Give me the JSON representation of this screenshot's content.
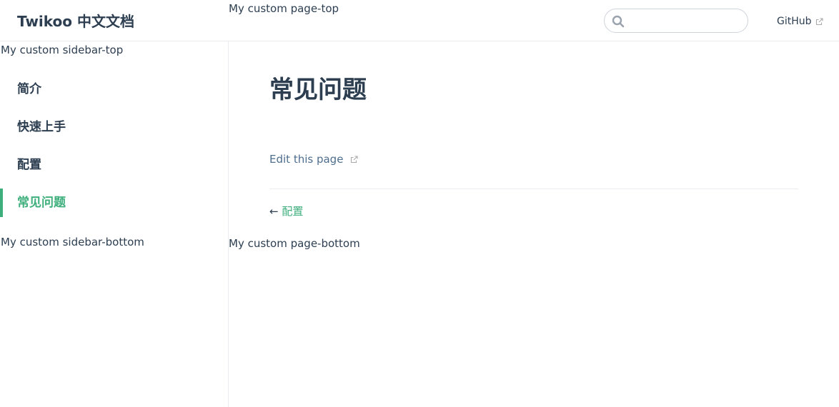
{
  "navbar": {
    "site_name": "Twikoo 中文文档",
    "search": {
      "value": "",
      "placeholder": ""
    },
    "links": [
      {
        "label": "GitHub"
      }
    ]
  },
  "page_top": "My custom page-top",
  "sidebar": {
    "top": "My custom sidebar-top",
    "items": [
      {
        "label": "简介",
        "active": false
      },
      {
        "label": "快速上手",
        "active": false
      },
      {
        "label": "配置",
        "active": false
      },
      {
        "label": "常见问题",
        "active": true
      }
    ],
    "bottom": "My custom sidebar-bottom"
  },
  "main": {
    "title": "常见问题",
    "edit_link": "Edit this page",
    "prev": {
      "arrow": "←",
      "label": "配置"
    }
  },
  "page_bottom": "My custom page-bottom",
  "colors": {
    "accent": "#3eaf7c",
    "text": "#2c3e50",
    "border": "#eaecef"
  },
  "icons": {
    "search": "search-icon",
    "external": "outbound-link-icon"
  }
}
